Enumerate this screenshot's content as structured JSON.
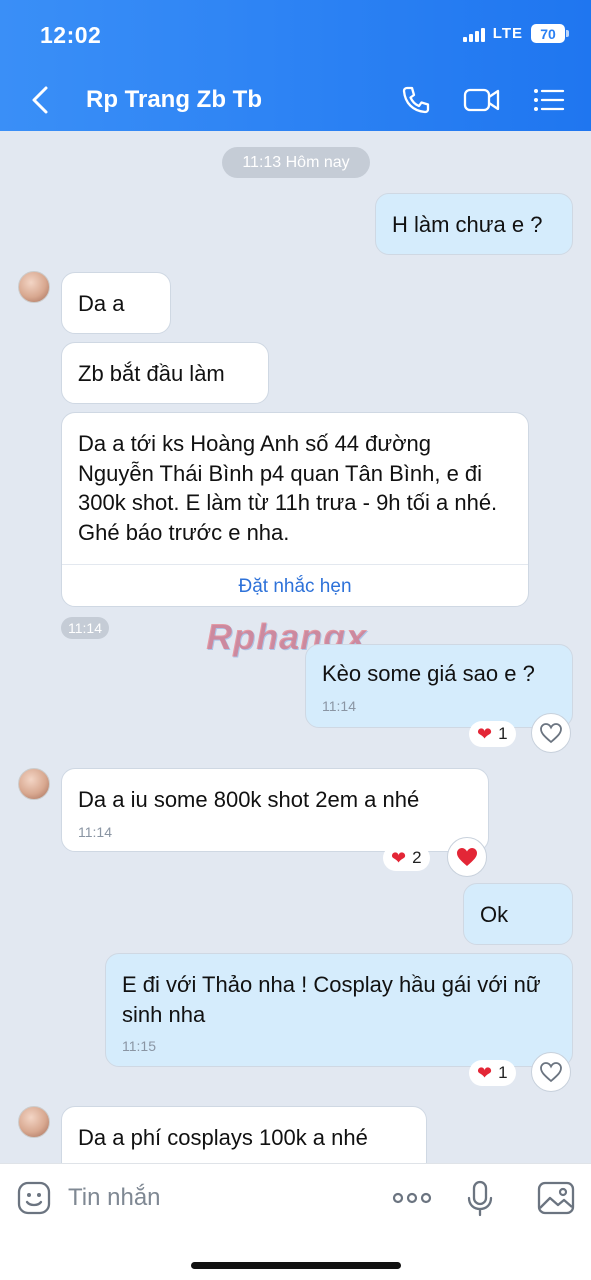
{
  "status": {
    "time": "12:02",
    "network": "LTE",
    "battery": "70"
  },
  "header": {
    "title": "Rp Trang Zb Tb"
  },
  "chat": {
    "date_pill": "11:13 Hôm nay",
    "watermark": "Rphangx",
    "messages": [
      {
        "text": "H làm chưa e ?"
      },
      {
        "text": "Da a"
      },
      {
        "text": "Zb bắt đầu làm"
      },
      {
        "text": "Da a tới ks Hoàng Anh số 44 đường Nguyễn Thái Bình p4 quan Tân Bình, e đi 300k shot. E làm từ 11h trưa - 9h tối a nhé. Ghé báo trước e nha.",
        "action": "Đặt nhắc hẹn",
        "time": "11:14"
      },
      {
        "text": "Kèo some giá sao e ?",
        "time": "11:14",
        "reaction_count": "1"
      },
      {
        "text": "Da a iu some 800k shot 2em a nhé",
        "time": "11:14",
        "reaction_count": "2"
      },
      {
        "text": "Ok"
      },
      {
        "text": "E đi với Thảo nha ! Cosplay hầu gái với nữ sinh nha",
        "time": "11:15",
        "reaction_count": "1"
      },
      {
        "text": "Da a phí cosplays 100k a nhé"
      }
    ]
  },
  "composer": {
    "placeholder": "Tin nhắn"
  },
  "icons": {
    "back": "chevron-left-icon",
    "call": "phone-icon",
    "video": "video-icon",
    "menu": "menu-list-icon",
    "emoji": "emoji-icon",
    "more": "more-dots-icon",
    "mic": "microphone-icon",
    "image": "image-icon",
    "heart": "heart-icon"
  },
  "colors": {
    "header": "#2a80f3",
    "outgoing": "#d5ecfc",
    "incoming": "#ffffff",
    "background": "#e2e8f1",
    "link": "#2e72d9",
    "heart": "#e32636"
  }
}
